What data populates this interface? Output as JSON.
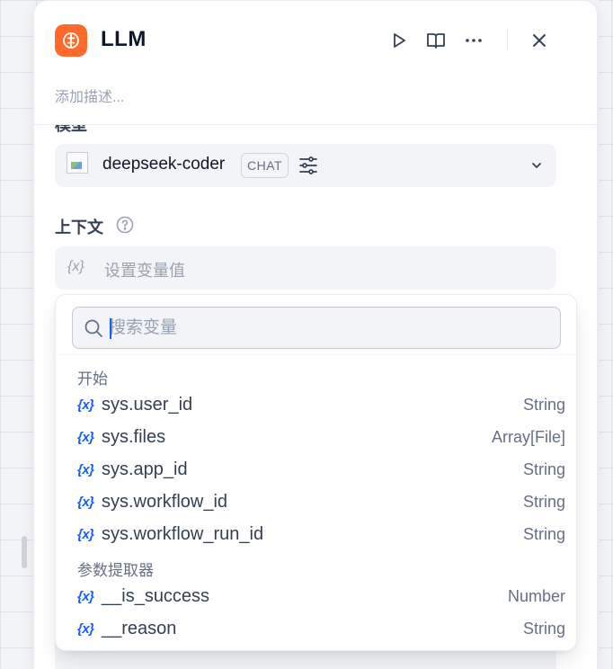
{
  "header": {
    "title": "LLM",
    "description_placeholder": "添加描述...",
    "icons": [
      "run-icon",
      "book-icon",
      "more-icon",
      "close-icon"
    ]
  },
  "model_section": {
    "label": "模型",
    "model_name": "deepseek-coder",
    "mode_badge": "CHAT"
  },
  "context_section": {
    "label": "上下文",
    "variable_icon": "{x}",
    "placeholder": "设置变量值"
  },
  "dropdown": {
    "search_placeholder": "搜索变量",
    "groups": [
      {
        "title": "开始",
        "items": [
          {
            "icon": "{x}",
            "name": "sys.user_id",
            "type": "String"
          },
          {
            "icon": "{x}",
            "name": "sys.files",
            "type": "Array[File]"
          },
          {
            "icon": "{x}",
            "name": "sys.app_id",
            "type": "String"
          },
          {
            "icon": "{x}",
            "name": "sys.workflow_id",
            "type": "String"
          },
          {
            "icon": "{x}",
            "name": "sys.workflow_run_id",
            "type": "String"
          }
        ]
      },
      {
        "title": "参数提取器",
        "items": [
          {
            "icon": "{x}",
            "name": "__is_success",
            "type": "Number"
          },
          {
            "icon": "{x}",
            "name": "__reason",
            "type": "String"
          }
        ]
      }
    ]
  },
  "colors": {
    "accent": "#155eef",
    "node_icon_bg": "#ff6a2c",
    "muted_text": "#98a2b3"
  }
}
